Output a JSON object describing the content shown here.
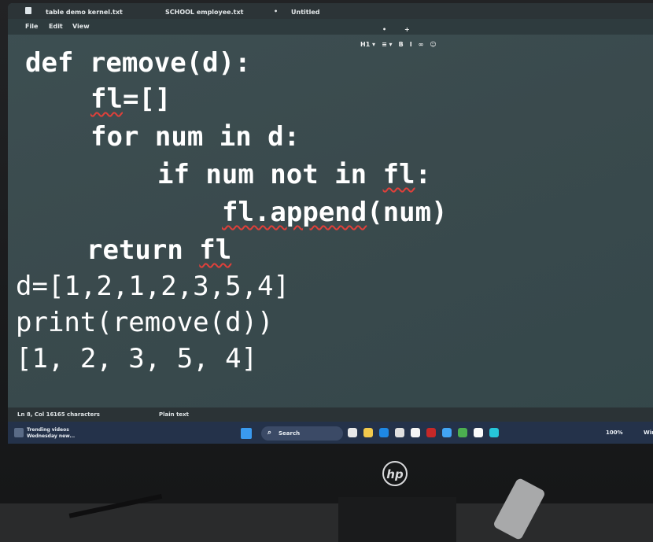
{
  "window": {
    "tabs": [
      "table demo kernel.txt",
      "SCHOOL employee.txt",
      "Untitled"
    ],
    "add_tab": "+"
  },
  "menu": [
    "File",
    "Edit",
    "View"
  ],
  "toolbar": {
    "heading": "H1 ▾",
    "list": "≡ ▾",
    "bold": "B",
    "italic": "I",
    "link": "∞",
    "emoji": "☺"
  },
  "code_lines": [
    "def remove(d):",
    "fl=[]",
    "for num in d:",
    "if num not in fl:",
    "fl.append(num)",
    "return fl",
    "d=[1,2,1,2,3,5,4]",
    "print(remove(d))",
    "[1, 2, 3, 5, 4]"
  ],
  "code_parts": {
    "l2_var": "fl",
    "l2_rest": "=[]",
    "l4_pre": "if num not in ",
    "l4_var": "fl",
    "l4_post": ":",
    "l5_call": "fl.append",
    "l5_args": "(num)",
    "l6_pre": "return ",
    "l6_var": "fl"
  },
  "statusbar": {
    "position": "Ln 8, Col 16",
    "chars": "165 characters",
    "format": "Plain text"
  },
  "taskbar": {
    "notification_line1": "Trending videos",
    "notification_line2": "Wednesday new...",
    "search": "Search",
    "zoom": "100%",
    "extra": "Win"
  },
  "logo": "hp",
  "colors": {
    "editor_bg": "#3a4a4d",
    "squiggle": "#e0403a",
    "taskbar": "#24324a"
  }
}
